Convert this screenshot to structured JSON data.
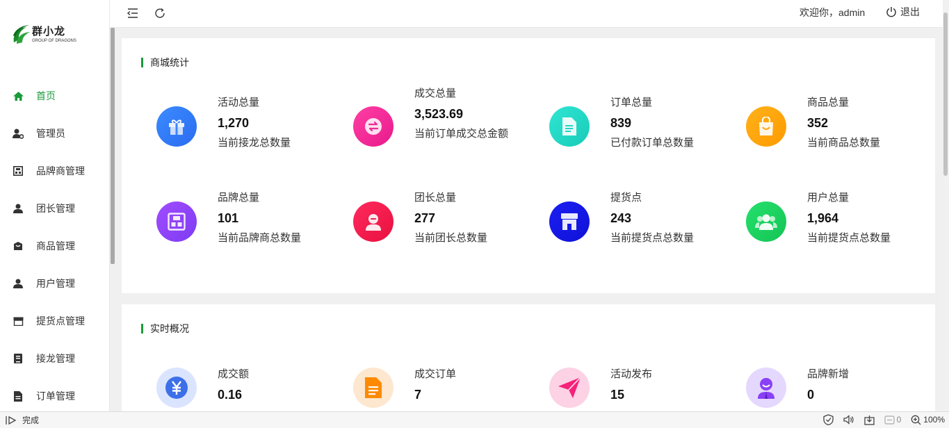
{
  "app": {
    "logo_cn": "群小龙",
    "logo_en": "GROUP OF DRAGONS"
  },
  "header": {
    "welcome": "欢迎你，admin",
    "logout_label": "退出"
  },
  "sidebar": {
    "items": [
      {
        "label": "首页",
        "icon": "home-icon",
        "active": true
      },
      {
        "label": "管理员",
        "icon": "admin-user-icon"
      },
      {
        "label": "品牌商管理",
        "icon": "brand-icon"
      },
      {
        "label": "团长管理",
        "icon": "person-icon"
      },
      {
        "label": "商品管理",
        "icon": "goods-box-icon"
      },
      {
        "label": "用户管理",
        "icon": "user-icon"
      },
      {
        "label": "提货点管理",
        "icon": "store-icon"
      },
      {
        "label": "接龙管理",
        "icon": "relay-book-icon"
      },
      {
        "label": "订单管理",
        "icon": "order-doc-icon"
      }
    ]
  },
  "mall_stats": {
    "title": "商城统计",
    "items": [
      {
        "label": "活动总量",
        "value": "1,270",
        "desc": "当前接龙总数量",
        "icon": "gift-icon"
      },
      {
        "label": "成交总量",
        "value": "3,523.69",
        "desc": "当前订单成交总金额",
        "icon": "exchange-icon"
      },
      {
        "label": "订单总量",
        "value": "839",
        "desc": "已付款订单总数量",
        "icon": "document-icon"
      },
      {
        "label": "商品总量",
        "value": "352",
        "desc": "当前商品总数量",
        "icon": "shopping-bag-icon"
      },
      {
        "label": "品牌总量",
        "value": "101",
        "desc": "当前品牌商总数量",
        "icon": "brand-grid-icon"
      },
      {
        "label": "团长总量",
        "value": "277",
        "desc": "当前团长总数量",
        "icon": "leader-icon"
      },
      {
        "label": "提货点",
        "value": "243",
        "desc": "当前提货点总数量",
        "icon": "shop-icon"
      },
      {
        "label": "用户总量",
        "value": "1,964",
        "desc": "当前提货点总数量",
        "icon": "users-group-icon"
      }
    ]
  },
  "realtime": {
    "title": "实时概况",
    "items": [
      {
        "label": "成交额",
        "value": "0.16",
        "icon": "yuan-icon"
      },
      {
        "label": "成交订单",
        "value": "7",
        "icon": "order-file-icon"
      },
      {
        "label": "活动发布",
        "value": "15",
        "icon": "paper-plane-icon"
      },
      {
        "label": "品牌新增",
        "value": "0",
        "icon": "brand-person-icon"
      }
    ]
  },
  "statusbar": {
    "status": "完成",
    "count": "0",
    "zoom": "100%"
  },
  "colors": {
    "accent": "#1a9a3a"
  }
}
